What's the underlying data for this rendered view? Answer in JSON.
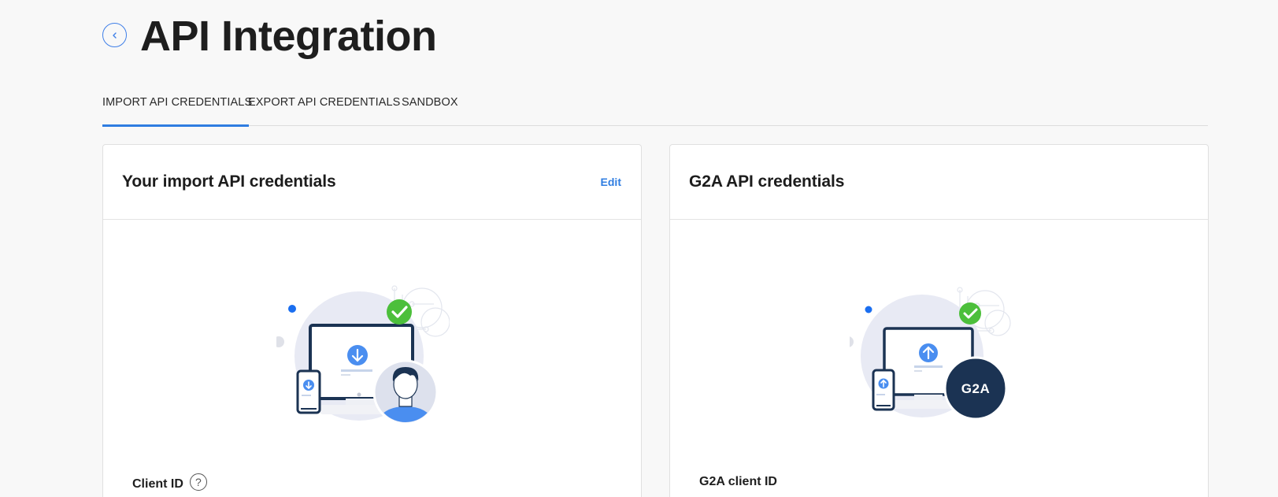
{
  "header": {
    "title": "API Integration",
    "back_icon": "chevron-left-icon"
  },
  "tabs": [
    {
      "label": "IMPORT API CREDENTIALS",
      "active": true
    },
    {
      "label": "EXPORT API CREDENTIALS",
      "active": false
    },
    {
      "label": "SANDBOX",
      "active": false
    }
  ],
  "import_card": {
    "title": "Your import API credentials",
    "edit_label": "Edit",
    "illustration": "import-credentials-illustration",
    "field_label": "Client ID",
    "help_icon": "?"
  },
  "g2a_card": {
    "title": "G2A API credentials",
    "illustration": "g2a-credentials-illustration",
    "badge_text": "G2A",
    "field_label": "G2A client ID"
  },
  "colors": {
    "accent": "#2f7de1",
    "background": "#f8f8f8",
    "navy": "#1b3353",
    "success": "#48b83a"
  }
}
